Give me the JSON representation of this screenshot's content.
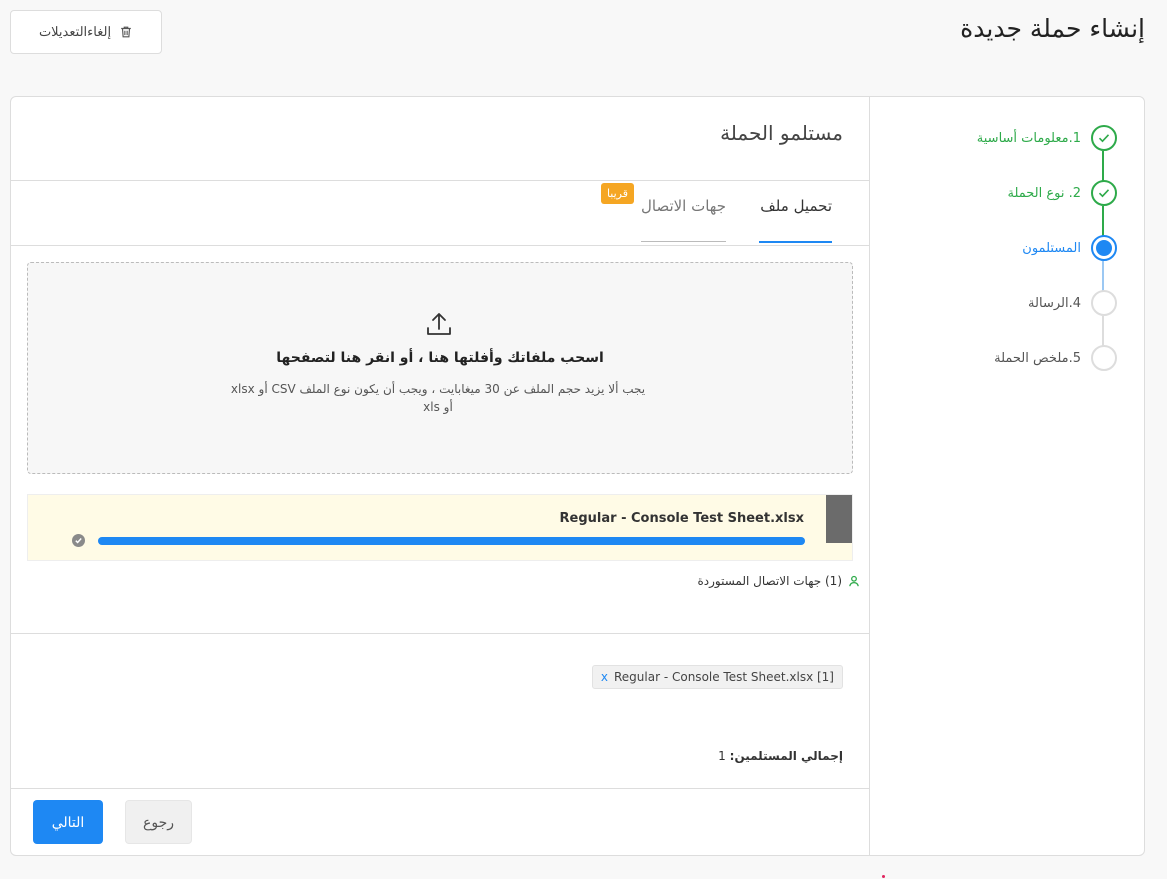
{
  "header": {
    "page_title": "إنشاء حملة جديدة",
    "cancel_label": "إلغاءالتعديلات"
  },
  "steps": [
    {
      "label": "1.معلومات أساسية",
      "state": "done"
    },
    {
      "label": "2. نوع الحملة",
      "state": "done"
    },
    {
      "label": "المستلمون",
      "state": "active"
    },
    {
      "label": "4.الرسالة",
      "state": "pending"
    },
    {
      "label": "5.ملخص الحملة",
      "state": "pending"
    }
  ],
  "main": {
    "section_title": "مستلمو الحملة",
    "tabs": {
      "upload": "تحميل ملف",
      "contacts": "جهات الاتصال",
      "soon_badge": "قريبا"
    },
    "dropzone": {
      "title": "اسحب ملفاتك وأفلتها هنا ، أو انقر هنا لتصفحها",
      "hint": "يجب ألا يزيد حجم الملف عن 30 ميغابايت ، ويجب أن يكون نوع الملف CSV أو xlsx أو xls"
    },
    "file": {
      "name": "Regular - Console Test Sheet.xlsx",
      "progress": 1.0
    },
    "imported_text": "(1) جهات الاتصال المستوردة",
    "recipient_tag": "Regular - Console Test Sheet.xlsx [1]",
    "recipient_tag_close": "x",
    "total_label": "إجمالي المستلمين:",
    "total_value": "1"
  },
  "footer": {
    "next_label": "التالي",
    "back_label": "رجوع"
  },
  "colors": {
    "accent": "#1e88f3",
    "success": "#2eaa4a",
    "badge": "#f5a623"
  }
}
